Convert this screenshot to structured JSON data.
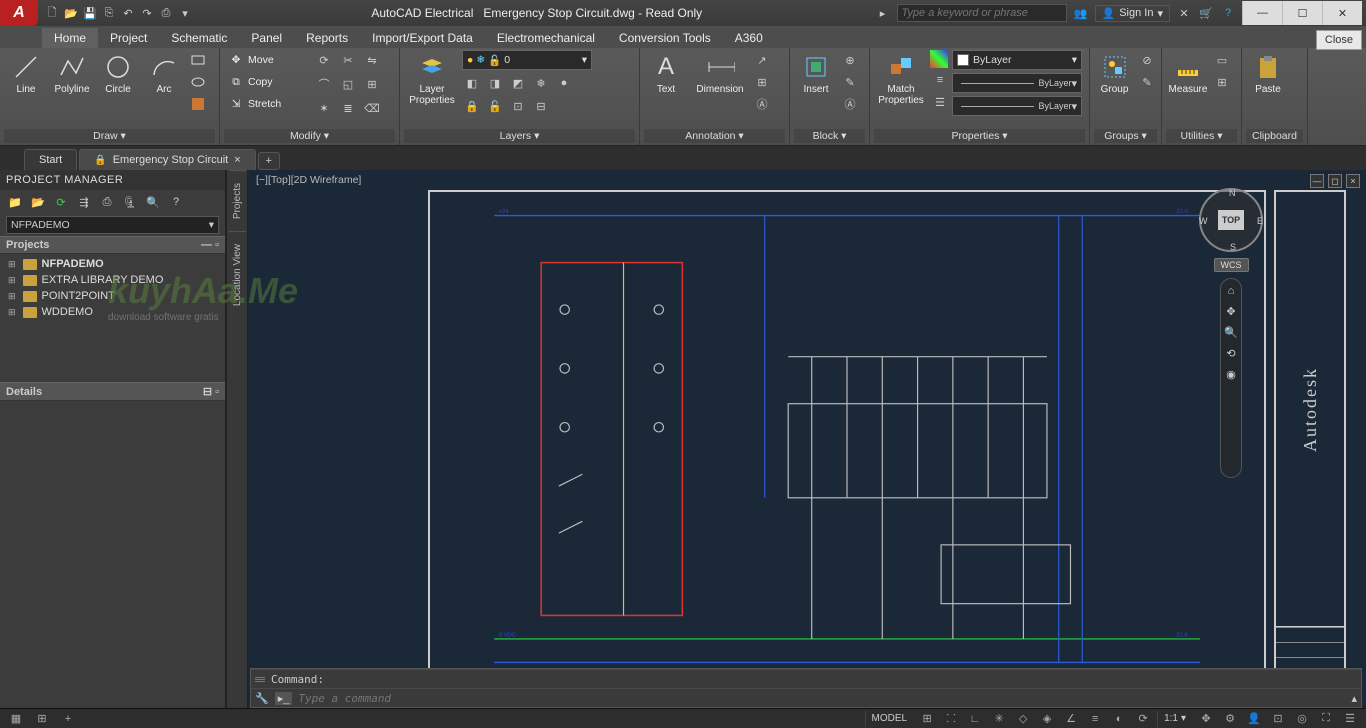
{
  "title": {
    "app": "AutoCAD Electrical",
    "doc": "Emergency Stop Circuit.dwg - Read Only"
  },
  "search": {
    "placeholder": "Type a keyword or phrase"
  },
  "signin": {
    "label": "Sign In"
  },
  "close_btn": "Close",
  "tabs": [
    "Home",
    "Project",
    "Schematic",
    "Panel",
    "Reports",
    "Import/Export Data",
    "Electromechanical",
    "Conversion Tools",
    "A360"
  ],
  "ribbon": {
    "draw": {
      "label": "Draw ▾",
      "items": [
        "Line",
        "Polyline",
        "Circle",
        "Arc"
      ]
    },
    "modify": {
      "label": "Modify ▾",
      "move": "Move",
      "copy": "Copy",
      "stretch": "Stretch"
    },
    "layer": {
      "label": "Layers ▾",
      "btn": "Layer\nProperties",
      "value": "0"
    },
    "annotation": {
      "label": "Annotation ▾",
      "text": "Text",
      "dim": "Dimension"
    },
    "block": {
      "label": "Block ▾",
      "insert": "Insert"
    },
    "properties": {
      "label": "Properties ▾",
      "match": "Match\nProperties",
      "bylayer": "ByLayer",
      "bylayer2": "ByLayer",
      "bylayer3": "ByLayer"
    },
    "groups": {
      "label": "Groups ▾",
      "group": "Group"
    },
    "utilities": {
      "label": "Utilities ▾",
      "measure": "Measure"
    },
    "clipboard": {
      "label": "Clipboard",
      "paste": "Paste"
    }
  },
  "doctabs": {
    "start": "Start",
    "active": "Emergency Stop Circuit"
  },
  "project_manager": {
    "title": "PROJECT MANAGER",
    "combo": "NFPADEMO",
    "sections": {
      "projects": "Projects",
      "details": "Details"
    },
    "tree": [
      "NFPADEMO",
      "EXTRA LIBRARY DEMO",
      "POINT2POINT",
      "WDDEMO"
    ]
  },
  "vtabs": [
    "Projects",
    "Location View"
  ],
  "canvas": {
    "label": "[−][Top][2D Wireframe]",
    "cube": "TOP",
    "wcs": "WCS",
    "dirs": {
      "n": "N",
      "s": "S",
      "e": "E",
      "w": "W"
    },
    "brand": "Autodesk"
  },
  "command": {
    "hist": "Command:",
    "placeholder": "Type a command"
  },
  "status": {
    "model": "MODEL",
    "scale": "1:1"
  },
  "watermark": {
    "text": "kuyhAa.Me",
    "sub": "download software gratis"
  }
}
